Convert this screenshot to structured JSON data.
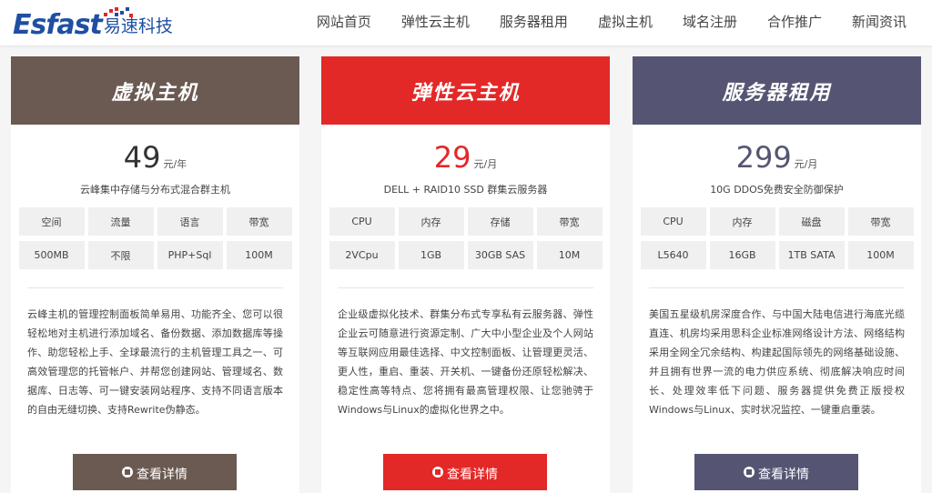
{
  "header": {
    "logo_en": "Esfast",
    "logo_cn": "易速科技",
    "nav": [
      "网站首页",
      "弹性云主机",
      "服务器租用",
      "虚拟主机",
      "域名注册",
      "合作推广",
      "新闻资讯"
    ]
  },
  "colors": {
    "brand": "#1f4fa3",
    "card1": "#6b5a52",
    "card2": "#e32828",
    "card3": "#555573"
  },
  "cards": [
    {
      "title": "虚拟主机",
      "price": "49",
      "unit": "元/年",
      "subtitle": "云峰集中存储与分布式混合群主机",
      "specs": [
        "空间",
        "流量",
        "语言",
        "带宽",
        "500MB",
        "不限",
        "PHP+Sql",
        "100M"
      ],
      "desc": "云峰主机的管理控制面板简单易用、功能齐全、您可以很轻松地对主机进行添加域名、备份数据、添加数据库等操作、助您轻松上手、全球最流行的主机管理工具之一、可高效管理您的托管帐户、并帮您创建网站、管理域名、数据库、日志等、可一键安装网站程序、支持不同语言版本的自由无缝切换、支持Rewrite伪静态。",
      "button": "查看详情"
    },
    {
      "title": "弹性云主机",
      "price": "29",
      "unit": "元/月",
      "subtitle": "DELL + RAID10 SSD 群集云服务器",
      "specs": [
        "CPU",
        "内存",
        "存储",
        "带宽",
        "2VCpu",
        "1GB",
        "30GB SAS",
        "10M"
      ],
      "desc": "企业级虚拟化技术、群集分布式专享私有云服务器、弹性企业云可随意进行资源定制、广大中小型企业及个人网站等互联网应用最佳选择、中文控制面板、让管理更灵活、更人性，重启、重装、开关机、一键备份还原轻松解决、稳定性高等特点、您将拥有最高管理权限、让您驰骋于Windows与Linux的虚拟化世界之中。",
      "button": "查看详情"
    },
    {
      "title": "服务器租用",
      "price": "299",
      "unit": "元/月",
      "subtitle": "10G DDOS免费安全防御保护",
      "specs": [
        "CPU",
        "内存",
        "磁盘",
        "带宽",
        "L5640",
        "16GB",
        "1TB SATA",
        "100M"
      ],
      "desc": "美国五星级机房深度合作、与中国大陆电信进行海底光缆直连、机房均采用思科企业标准网络设计方法、网络结构采用全网全冗余结构、构建起国际领先的网络基础设施、并且拥有世界一流的电力供应系统、彻底解决响应时间长、处理效率低下问题、服务器提供免费正版授权Windows与Linux、实时状况监控、一键重启重装。",
      "button": "查看详情"
    }
  ]
}
